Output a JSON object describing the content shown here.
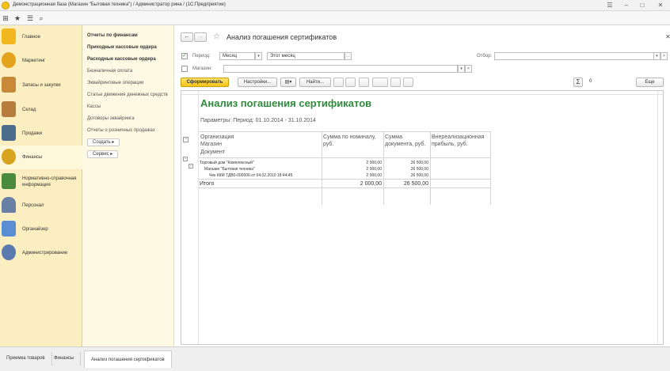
{
  "window": {
    "title": "Демонстрационная база (Магазин \"Бытовая техника\") / Администратор рина / (1С:Предприятие)"
  },
  "sections": [
    {
      "label": "Главное",
      "icon": "home-icon",
      "color": "#f2b71f"
    },
    {
      "label": "Маркетинг",
      "icon": "pie-chart-icon",
      "color": "#e3a31c"
    },
    {
      "label": "Запасы и закупки",
      "icon": "boxes-icon",
      "color": "#c9893a"
    },
    {
      "label": "Склад",
      "icon": "warehouse-icon",
      "color": "#b77d3d"
    },
    {
      "label": "Продажи",
      "icon": "cash-register-icon",
      "color": "#4b6c8a"
    },
    {
      "label": "Финансы",
      "icon": "coins-icon",
      "color": "#d8a420"
    },
    {
      "label": "Нормативно-справочная информация",
      "icon": "books-icon",
      "color": "#4a8a3c"
    },
    {
      "label": "Персонал",
      "icon": "person-icon",
      "color": "#6a7fa6"
    },
    {
      "label": "Органайзер",
      "icon": "organizer-icon",
      "color": "#5a8ed3"
    },
    {
      "label": "Администрирование",
      "icon": "gears-icon",
      "color": "#5b7bb0"
    }
  ],
  "nav": {
    "bold_items": [
      "Отчеты по финансам",
      "Приходные кассовые ордера",
      "Расходные кассовые ордера"
    ],
    "items": [
      "Безналичная оплата",
      "Эквайринговые операции",
      "Статьи движения денежных средств",
      "Кассы",
      "Договоры эквайринга",
      "Отчеты о розничных продажах"
    ],
    "create_label": "Создать ▸",
    "service_label": "Сервис ▸"
  },
  "form": {
    "title": "Анализ погашения сертификатов",
    "period_label": "Период:",
    "period_kind": "Месяц",
    "period_value": "Этот месяц",
    "store_label": "Магазин:",
    "filter_label": "Отбор:",
    "generate_label": "Сформировать",
    "settings_label": "Настройки...",
    "find_label": "Найти...",
    "sum_value": "0",
    "more_label": "Еще"
  },
  "report": {
    "title": "Анализ погашения сертификатов",
    "params": "Параметры:   Период: 01.10.2014 - 31.10.2014",
    "headers": {
      "col1": [
        "Организация",
        "Магазин",
        "Документ"
      ],
      "col2": "Сумма по номиналу, руб.",
      "col3": "Сумма документа, руб.",
      "col4": "Внереализационная прибыль, руб."
    },
    "rows": [
      {
        "name": "Торговый дом \"Комплексный\"",
        "nominal": "2 000,00",
        "doc": "26 500,00"
      },
      {
        "name": "Магазин \"Бытовая техника\"",
        "nominal": "2 000,00",
        "doc": "26 500,00"
      },
      {
        "name": "Чек ККМ ТДВ0-000006 от 04.02.2010 18:44:45",
        "nominal": "2 000,00",
        "doc": "26 500,00"
      }
    ],
    "total": {
      "label": "Итого",
      "nominal": "2 000,00",
      "doc": "26 500,00"
    }
  },
  "tabs": [
    "Приемка товаров",
    "Финансы",
    "Анализ погашения сертификатов"
  ]
}
